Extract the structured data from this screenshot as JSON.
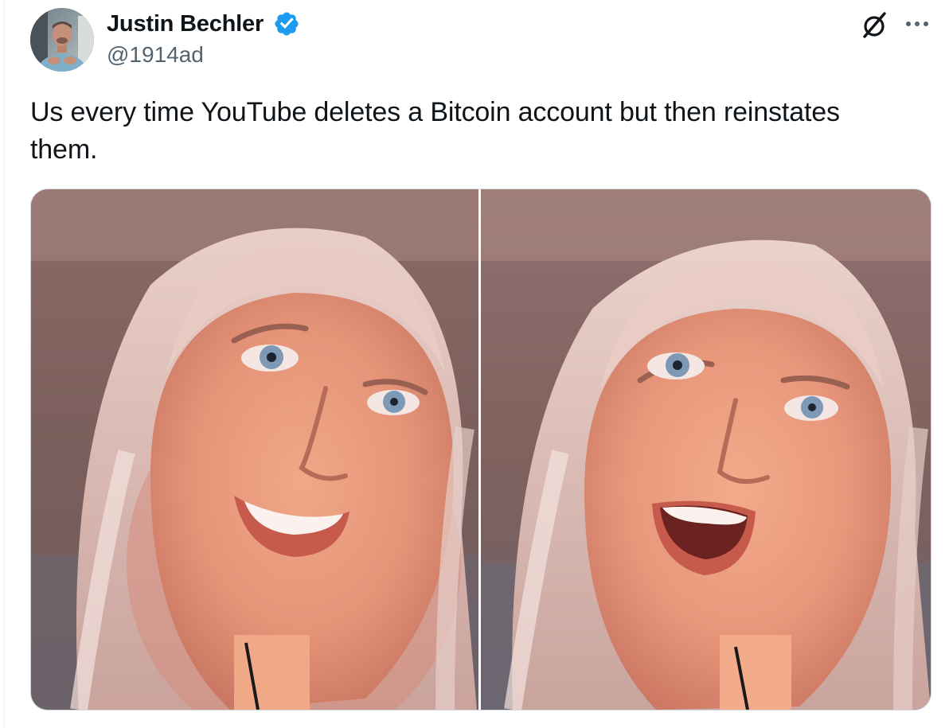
{
  "author": {
    "name": "Justin Bechler",
    "handle": "@1914ad",
    "verified": true,
    "verified_color": "#1d9bf0"
  },
  "actions": {
    "grok_icon": "grok-icon",
    "more_icon": "more-dots-icon"
  },
  "tweet": {
    "text": "Us every time YouTube deletes a Bitcoin account but then reinstates them."
  },
  "media": {
    "count": 2,
    "photos": [
      {
        "description": "smiling-woman-left"
      },
      {
        "description": "smiling-woman-right-open-mouth"
      }
    ]
  },
  "colors": {
    "text": "#0f1419",
    "secondary": "#536471",
    "border": "#cfd9de",
    "accent": "#1d9bf0"
  }
}
